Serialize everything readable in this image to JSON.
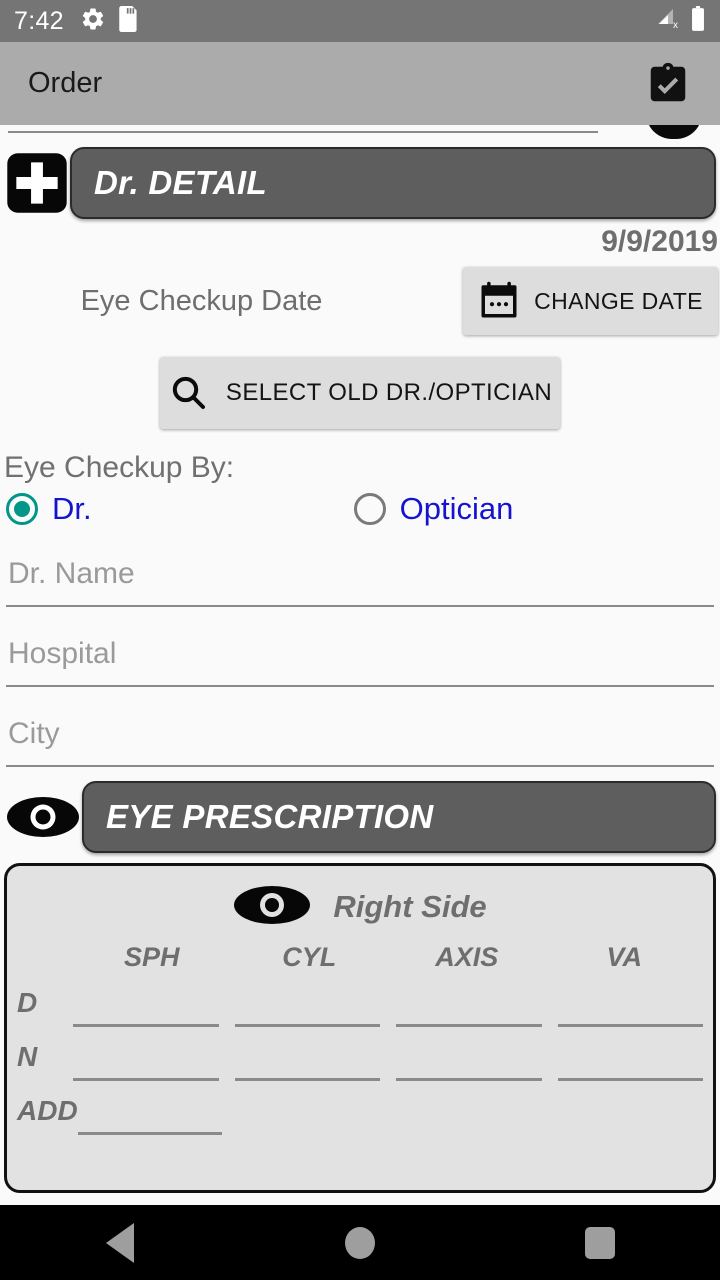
{
  "statusbar": {
    "time": "7:42",
    "icons_left": [
      "gear-icon",
      "sd-card-icon"
    ],
    "icons_right": [
      "signal-no-service-icon",
      "battery-full-icon"
    ]
  },
  "appbar": {
    "title": "Order",
    "action_icon": "clipboard-check-icon",
    "background": "#ababab"
  },
  "doctor_section": {
    "icon": "medical-cross-icon",
    "banner_title": "Dr. DETAIL",
    "date_value": "9/9/2019",
    "date_label": "Eye Checkup Date",
    "change_date_button": {
      "label": "CHANGE DATE",
      "icon": "calendar-icon"
    },
    "select_old_button": {
      "label": "SELECT OLD DR./OPTICIAN",
      "icon": "search-icon"
    },
    "checkup_by_label": "Eye Checkup By:",
    "radio_options": [
      {
        "label": "Dr.",
        "selected": true,
        "color": "#009688"
      },
      {
        "label": "Optician",
        "selected": false,
        "color": "#7a7a7a"
      }
    ],
    "radio_label_color": "#1414d0",
    "fields": [
      {
        "placeholder": "Dr. Name",
        "value": ""
      },
      {
        "placeholder": "Hospital",
        "value": ""
      },
      {
        "placeholder": "City",
        "value": ""
      }
    ]
  },
  "prescription_section": {
    "icon": "eye-icon",
    "banner_title": "EYE PRESCRIPTION",
    "side_icon": "eye-icon",
    "side_title": "Right Side",
    "columns": [
      "SPH",
      "CYL",
      "AXIS",
      "VA"
    ],
    "rows": [
      {
        "label": "D",
        "values": [
          "",
          "",
          "",
          ""
        ],
        "cells": 4
      },
      {
        "label": "N",
        "values": [
          "",
          "",
          "",
          ""
        ],
        "cells": 4
      },
      {
        "label": "ADD",
        "values": [
          "",
          "",
          "",
          ""
        ],
        "cells": 1
      }
    ]
  },
  "navbar": {
    "back": "back-triangle-icon",
    "home": "home-circle-icon",
    "recent": "recent-square-icon"
  }
}
